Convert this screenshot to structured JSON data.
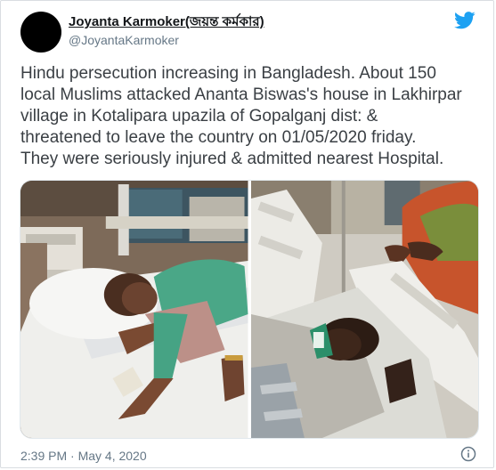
{
  "tweet": {
    "author_name": "Joyanta Karmoker(জয়ন্ত কর্মকার)",
    "author_handle": "@JoyantaKarmoker",
    "text_lines": [
      "Hindu persecution increasing in Bangladesh. About 150",
      "local Muslims attacked Ananta Biswas's house in Lakhirpar",
      "village in Kotalipara upazila of Gopalganj dist: &",
      "threatened to leave the country on 01/05/2020 friday.",
      "They were seriously injured &  admitted nearest Hospital."
    ],
    "timestamp": "2:39 PM · May 4, 2020"
  },
  "icons": {
    "brand": "twitter-bird-icon",
    "info": "info-icon"
  },
  "colors": {
    "twitter_blue": "#1da1f2",
    "text_primary": "#14171a",
    "text_secondary": "#657786",
    "border": "#e1e8ed"
  }
}
